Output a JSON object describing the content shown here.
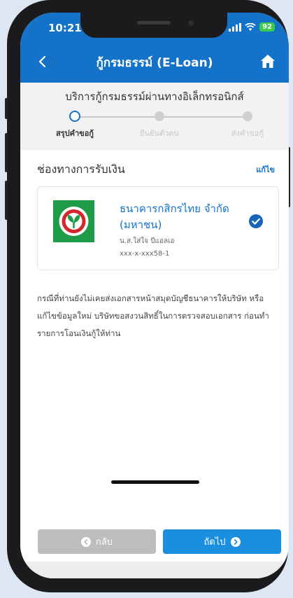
{
  "status": {
    "time": "10:21",
    "battery": "92"
  },
  "header": {
    "title": "กู้กรมธรรม์ (E-Loan)"
  },
  "steps": {
    "subtitle": "บริการกู้กรมธรรม์ผ่านทางอิเล็กทรอนิกส์",
    "items": [
      {
        "label": "สรุปคำขอกู้",
        "state": "active"
      },
      {
        "label": "ยืนยันตัวตน",
        "state": "inactive"
      },
      {
        "label": "ส่งคำขอกู้",
        "state": "inactive"
      }
    ]
  },
  "payment": {
    "section_title": "ช่องทางการรับเงิน",
    "edit_label": "แก้ไข",
    "bank_name": "ธนาคารกสิกรไทย จำกัด (มหาชน)",
    "account_name": "น.ส.ใส่ใจ บีแอลเอ",
    "account_no": "xxx-x-xxx58-1"
  },
  "note": "กรณีที่ท่านยังไม่เคยส่งเอกสารหน้าสมุดบัญชีธนาคารให้บริษัท หรือแก้ไขข้อมูลใหม่ บริษัทขอสงวนสิทธิ์ในการตรวจสอบเอกสาร ก่อนทำรายการโอนเงินกู้ให้ท่าน",
  "buttons": {
    "back": "กลับ",
    "next": "ถัดไป"
  },
  "colors": {
    "primary": "#1473c8",
    "kbank_green": "#1e9b46",
    "kbank_red": "#d6262a"
  },
  "icons": {
    "back": "chevron-left-icon",
    "home": "home-icon",
    "selected": "check-circle-icon"
  }
}
